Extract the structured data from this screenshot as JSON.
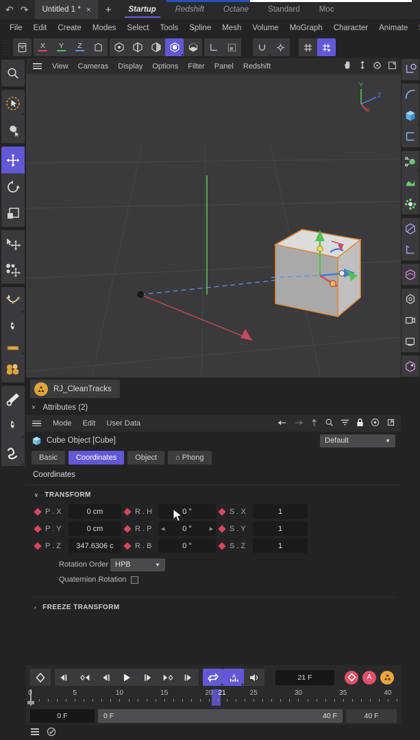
{
  "topbar": {
    "undo_icon": "undo-arrow-icon",
    "redo_icon": "redo-arrow-icon",
    "document_tab": "Untitled 1 *",
    "close_glyph": "×",
    "new_tab_glyph": "+",
    "layouts": [
      {
        "label": "Startup",
        "active": true
      },
      {
        "label": "Redshift",
        "active": false
      },
      {
        "label": "Octane",
        "active": false
      },
      {
        "label": "Standard",
        "active": false
      },
      {
        "label": "Moc",
        "active": false
      }
    ]
  },
  "menubar": {
    "items": [
      "File",
      "Edit",
      "Create",
      "Modes",
      "Select",
      "Tools",
      "Spline",
      "Mesh",
      "Volume",
      "MoGraph",
      "Character",
      "Animate",
      "Sim"
    ]
  },
  "toolbar": {
    "groups": [
      {
        "buttons": [
          {
            "name": "object-manager-icon",
            "glyph": "⬚"
          }
        ]
      },
      {
        "buttons": [
          {
            "name": "lock-x-axis-icon",
            "axis": "X",
            "color": "#d9485c"
          },
          {
            "name": "lock-y-axis-icon",
            "axis": "Y",
            "color": "#5fc05f"
          },
          {
            "name": "lock-z-axis-icon",
            "axis": "Z",
            "color": "#5b8fe0"
          },
          {
            "name": "world-object-coordinates-icon",
            "glyph": "⌶"
          }
        ]
      },
      {
        "buttons": [
          {
            "name": "point-mode-icon",
            "glyph": "⬡"
          },
          {
            "name": "edge-mode-icon",
            "glyph": "⬡"
          },
          {
            "name": "polygon-mode-icon",
            "glyph": "⬡"
          },
          {
            "name": "model-mode-icon",
            "glyph": "⬢",
            "selected": true
          },
          {
            "name": "texture-mode-icon",
            "glyph": "⬢"
          }
        ]
      },
      {
        "buttons": [
          {
            "name": "workplane-icon",
            "glyph": "∟"
          },
          {
            "name": "viewport-solo-icon",
            "glyph": "◰"
          }
        ]
      },
      {
        "buttons": [
          {
            "name": "snap-icon",
            "glyph": "↻"
          },
          {
            "name": "snap-settings-icon",
            "glyph": "⚙"
          }
        ]
      },
      {
        "buttons": [
          {
            "name": "grid-icon",
            "glyph": "♯"
          },
          {
            "name": "grid-lock-icon",
            "glyph": "♯",
            "selected": true
          }
        ]
      }
    ]
  },
  "left_tools": {
    "search_icon": "search-icon",
    "groups": [
      {
        "buttons": [
          {
            "name": "live-selection-tool-icon",
            "glyph": "➤",
            "dashed": true
          },
          {
            "name": "selection-settings-tool-icon",
            "glyph": "⚙"
          }
        ]
      },
      {
        "buttons": [
          {
            "name": "move-tool-icon",
            "glyph": "✤",
            "selected": true
          },
          {
            "name": "rotate-tool-icon",
            "glyph": "↺"
          },
          {
            "name": "scale-tool-icon",
            "glyph": "◰"
          }
        ]
      },
      {
        "buttons": [
          {
            "name": "transform-tool-icon",
            "glyph": "✤"
          },
          {
            "name": "soft-selection-tool-icon",
            "glyph": "✤"
          }
        ]
      },
      {
        "buttons": [
          {
            "name": "spline-pen-tool-icon",
            "glyph": "✐"
          },
          {
            "name": "polygon-pen-tool-icon",
            "glyph": "✐"
          },
          {
            "name": "material-tool-icon",
            "glyph": "■"
          },
          {
            "name": "sculpt-tool-icon",
            "glyph": "●"
          }
        ]
      },
      {
        "buttons": [
          {
            "name": "brush-tool-icon",
            "glyph": "╱"
          },
          {
            "name": "paint-tool-icon",
            "glyph": "✐"
          },
          {
            "name": "spline-draw-tool-icon",
            "glyph": "∿"
          }
        ]
      }
    ]
  },
  "viewport": {
    "menu_icon": "hamburger-icon",
    "menus": [
      "View",
      "Cameras",
      "Display",
      "Options",
      "Filter",
      "Panel",
      "Redshift"
    ],
    "right_icons": [
      {
        "name": "pan-hand-icon",
        "glyph": "✋"
      },
      {
        "name": "zoom-axis-icon",
        "glyph": "↕"
      },
      {
        "name": "rotate-view-icon",
        "glyph": "↻"
      },
      {
        "name": "maximize-view-icon",
        "glyph": "◱"
      }
    ],
    "gizmo": {
      "y": "Y",
      "z": "Z",
      "x": "X",
      "y_color": "#4fc24f",
      "z_color": "#4d7fe0",
      "x_color": "#d9485c"
    },
    "object_color": "#b5b5b5",
    "outline_color": "#e08a3c"
  },
  "object_tab": {
    "icon": "recycle-tracks-icon",
    "label": "RJ_CleanTracks",
    "icon_color": "#e0a33c"
  },
  "attributes": {
    "close_glyph": "×",
    "title": "Attributes (2)",
    "menu_icon": "hamburger-icon",
    "menus": [
      "Mode",
      "Edit",
      "User Data"
    ],
    "tool_icons": [
      {
        "name": "back-arrow-icon",
        "glyph": "←"
      },
      {
        "name": "forward-arrow-icon",
        "glyph": "→"
      },
      {
        "name": "up-arrow-icon",
        "glyph": "↑"
      },
      {
        "name": "search-icon",
        "glyph": "⌕"
      },
      {
        "name": "filter-icon",
        "glyph": "≣"
      },
      {
        "name": "lock-icon",
        "glyph": "ὑ2"
      },
      {
        "name": "record-target-icon",
        "glyph": "◎"
      },
      {
        "name": "open-external-icon",
        "glyph": "↗"
      }
    ],
    "object_icon": "cube-object-icon",
    "object_name": "Cube Object [Cube]",
    "preset_label": "Default",
    "preset_chevron": "▼",
    "tabs": [
      {
        "label": "Basic",
        "selected": false
      },
      {
        "label": "Coordinates",
        "selected": true
      },
      {
        "label": "Object",
        "selected": false
      },
      {
        "label": "⌂ Phong",
        "selected": false
      }
    ],
    "section_title": "Coordinates",
    "transform_group": {
      "chevron": "∨",
      "title": "TRANSFORM"
    },
    "fields": [
      {
        "pos_label": "P . X",
        "pos_value": "0 cm",
        "rot_label": "R . H",
        "rot_value": "0 °",
        "rot_arrows": false,
        "scl_label": "S . X",
        "scl_value": "1"
      },
      {
        "pos_label": "P . Y",
        "pos_value": "0 cm",
        "rot_label": "R . P",
        "rot_value": "0 °",
        "rot_arrows": true,
        "scl_label": "S . Y",
        "scl_value": "1"
      },
      {
        "pos_label": "P . Z",
        "pos_value": "347.6306 c",
        "rot_label": "R . B",
        "rot_value": "0 °",
        "rot_arrows": false,
        "scl_label": "S . Z",
        "scl_value": "1"
      }
    ],
    "rotation_order_label": "Rotation Order",
    "rotation_order_value": "HPB",
    "rotation_order_chevron": "▼",
    "quaternion_label": "Quaternion Rotation",
    "quaternion_checked": false,
    "freeze_group": {
      "chevron": "›",
      "title": "FREEZE TRANSFORM"
    },
    "keyframe_diamond_color": "#d9485c"
  },
  "timeline": {
    "record_group": [
      {
        "name": "record-keyframe-icon",
        "glyph": "◇"
      }
    ],
    "playback": [
      {
        "name": "go-to-start-icon",
        "glyph": "⧏❙"
      },
      {
        "name": "previous-keyframe-icon",
        "glyph": "◇◀"
      },
      {
        "name": "step-back-icon",
        "glyph": "◀❙"
      },
      {
        "name": "play-icon",
        "glyph": "▶"
      },
      {
        "name": "step-forward-icon",
        "glyph": "❙▶"
      },
      {
        "name": "next-keyframe-icon",
        "glyph": "▶◇"
      },
      {
        "name": "go-to-end-icon",
        "glyph": "❙⧐"
      }
    ],
    "options": [
      {
        "name": "loop-playback-icon",
        "glyph": "⇄",
        "on": true
      },
      {
        "name": "autokey-icon",
        "glyph": "A",
        "on": true
      },
      {
        "name": "sound-icon",
        "glyph": "🔊",
        "on": false
      }
    ],
    "current_frame": "21 F",
    "record_buttons": [
      {
        "name": "record-active-objects-icon",
        "glyph": "◇",
        "color": "#e0536a"
      },
      {
        "name": "autokeying-icon",
        "glyph": "A",
        "color": "#e0536a"
      },
      {
        "name": "keyframe-selection-icon",
        "glyph": "♲",
        "color": "#e8a63c"
      }
    ],
    "ruler": {
      "labels": [
        0,
        5,
        10,
        15,
        20,
        25,
        30,
        35,
        40
      ],
      "min": 0,
      "max": 41,
      "playhead_frame": 0,
      "selection_start": 20,
      "selection_end": 21,
      "selection_label": "21"
    },
    "frame_from": "0 F",
    "range_start": "0 F",
    "range_end": "40 F",
    "frame_to": "40 F"
  },
  "status_bar": {
    "icons": [
      {
        "name": "layers-icon",
        "glyph": "☰"
      },
      {
        "name": "check-circle-icon",
        "glyph": "✓"
      }
    ]
  },
  "right_tools": {
    "groups": [
      {
        "buttons": [
          {
            "name": "workplane-axis-icon",
            "color": "#b9b2e8"
          }
        ]
      },
      {
        "buttons": [
          {
            "name": "spline-arc-icon",
            "color": "#7fb3e8"
          },
          {
            "name": "primitive-cube-icon",
            "color": "#63b0e8"
          },
          {
            "name": "spline-pen-blue-icon",
            "color": "#7fb3e8"
          }
        ]
      },
      {
        "buttons": [
          {
            "name": "mograph-cloner-icon",
            "color": "#6cc96c"
          },
          {
            "name": "deformer-icon",
            "color": "#6cc96c"
          },
          {
            "name": "effector-icon",
            "color": "#6cc96c"
          }
        ]
      },
      {
        "buttons": [
          {
            "name": "generator-icon",
            "color": "#a89ce8"
          },
          {
            "name": "field-icon",
            "color": "#a89ce8"
          }
        ]
      },
      {
        "buttons": [
          {
            "name": "simulation-icon",
            "color": "#d08ad8"
          }
        ]
      },
      {
        "buttons": [
          {
            "name": "light-icon",
            "color": "#cfcfd1"
          },
          {
            "name": "camera-icon",
            "color": "#cfcfd1"
          },
          {
            "name": "render-view-icon",
            "color": "#cfcfd1"
          }
        ]
      },
      {
        "buttons": [
          {
            "name": "material-sphere-icon",
            "color": "#d08ad8"
          }
        ]
      }
    ]
  },
  "colors": {
    "accent_purple": "#6358d4",
    "panel_bg": "#232325",
    "viewport_bg": "#3a3a3c",
    "field_bg": "#1b1b1d",
    "red": "#d9485c",
    "green": "#5fc05f",
    "blue": "#5b8fe0",
    "orange": "#e0a33c"
  }
}
